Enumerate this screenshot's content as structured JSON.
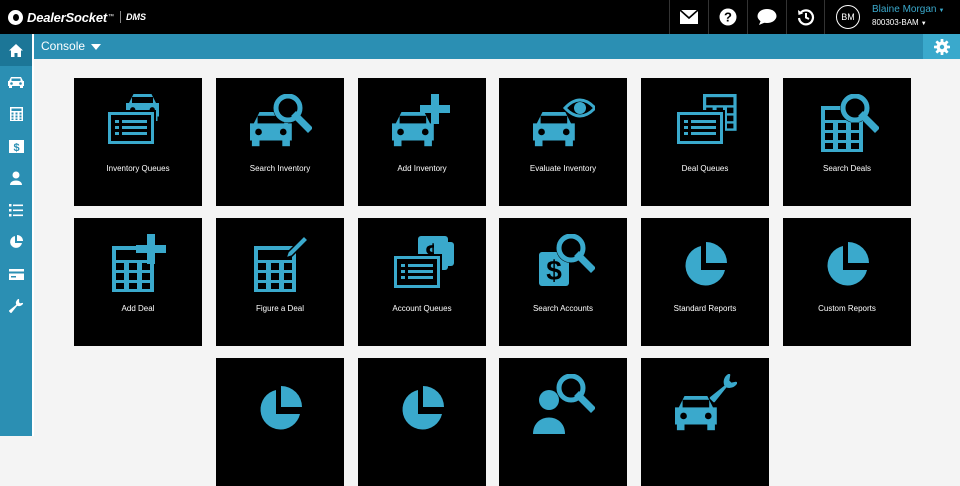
{
  "header": {
    "logo_text": "DealerSocket",
    "logo_tm": "™",
    "logo_product": "DMS",
    "user_name": "Blaine Morgan",
    "user_id": "800303-BAM",
    "avatar_initials": "BM",
    "icons": [
      "mail-icon",
      "help-icon",
      "chat-icon",
      "history-icon"
    ]
  },
  "console": {
    "label": "Console"
  },
  "sidebar": {
    "items": [
      "home-icon",
      "car-icon",
      "calculator-icon",
      "dollar-card-icon",
      "person-icon",
      "list-icon",
      "pie-chart-icon",
      "credit-card-icon",
      "wrench-icon"
    ]
  },
  "tiles": [
    {
      "label": "Inventory Queues",
      "icon": "car-list-icon"
    },
    {
      "label": "Search Inventory",
      "icon": "car-search-icon"
    },
    {
      "label": "Add Inventory",
      "icon": "car-add-icon"
    },
    {
      "label": "Evaluate Inventory",
      "icon": "car-eye-icon"
    },
    {
      "label": "Deal Queues",
      "icon": "calc-list-icon"
    },
    {
      "label": "Search Deals",
      "icon": "calc-search-icon"
    },
    {
      "label": "Add Deal",
      "icon": "calc-add-icon"
    },
    {
      "label": "Figure a Deal",
      "icon": "calc-pencil-icon"
    },
    {
      "label": "Account Queues",
      "icon": "dollar-list-icon"
    },
    {
      "label": "Search Accounts",
      "icon": "dollar-search-icon"
    },
    {
      "label": "Standard Reports",
      "icon": "pie-chart-icon"
    },
    {
      "label": "Custom Reports",
      "icon": "pie-chart-icon"
    },
    {
      "label": "",
      "icon": "pie-chart-icon"
    },
    {
      "label": "",
      "icon": "pie-chart-icon"
    },
    {
      "label": "",
      "icon": "person-search-icon"
    },
    {
      "label": "",
      "icon": "car-wrench-icon"
    }
  ],
  "colors": {
    "accent": "#3aa9cc",
    "sidebar": "#2b8fb3",
    "tile": "#000000"
  }
}
